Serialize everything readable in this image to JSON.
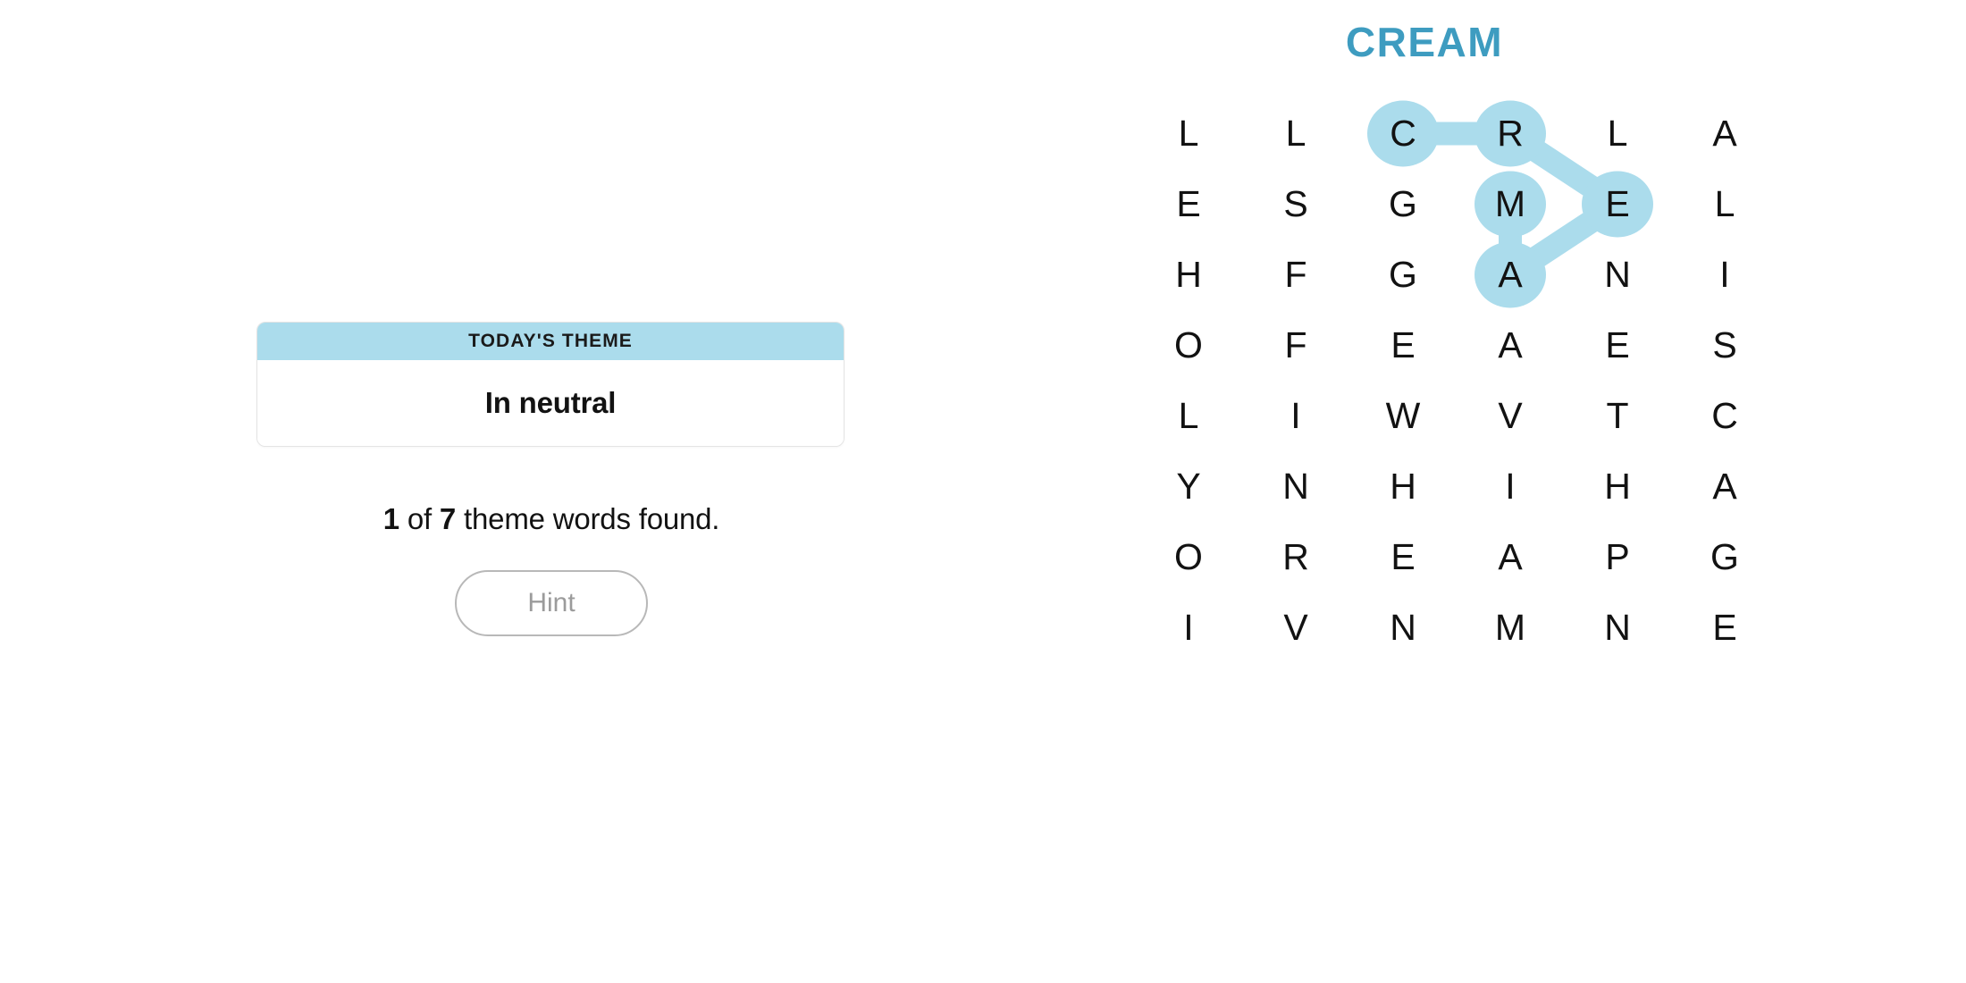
{
  "puzzle": {
    "title": "CREAM",
    "title_color": "#3e9cc0",
    "highlight_color": "#abdcec"
  },
  "theme_card": {
    "header": "TODAY'S THEME",
    "theme": "In neutral",
    "header_bg": "#abdcec"
  },
  "progress": {
    "found": "1",
    "total": "7",
    "prefix_of": " of ",
    "suffix": " theme words found."
  },
  "hint_button": {
    "label": "Hint"
  },
  "grid": {
    "rows": 8,
    "cols": 6,
    "letters": [
      [
        "L",
        "L",
        "C",
        "R",
        "L",
        "A"
      ],
      [
        "E",
        "S",
        "G",
        "M",
        "E",
        "L"
      ],
      [
        "H",
        "F",
        "G",
        "A",
        "N",
        "I"
      ],
      [
        "O",
        "F",
        "E",
        "A",
        "E",
        "S"
      ],
      [
        "L",
        "I",
        "W",
        "V",
        "T",
        "C"
      ],
      [
        "Y",
        "N",
        "H",
        "I",
        "H",
        "A"
      ],
      [
        "O",
        "R",
        "E",
        "A",
        "P",
        "G"
      ],
      [
        "I",
        "V",
        "N",
        "M",
        "N",
        "E"
      ]
    ],
    "found_words": [
      {
        "word": "CREAM",
        "path": [
          {
            "row": 0,
            "col": 2,
            "letter": "C"
          },
          {
            "row": 0,
            "col": 3,
            "letter": "R"
          },
          {
            "row": 1,
            "col": 4,
            "letter": "E"
          },
          {
            "row": 2,
            "col": 3,
            "letter": "A"
          },
          {
            "row": 1,
            "col": 3,
            "letter": "M"
          }
        ]
      }
    ]
  }
}
